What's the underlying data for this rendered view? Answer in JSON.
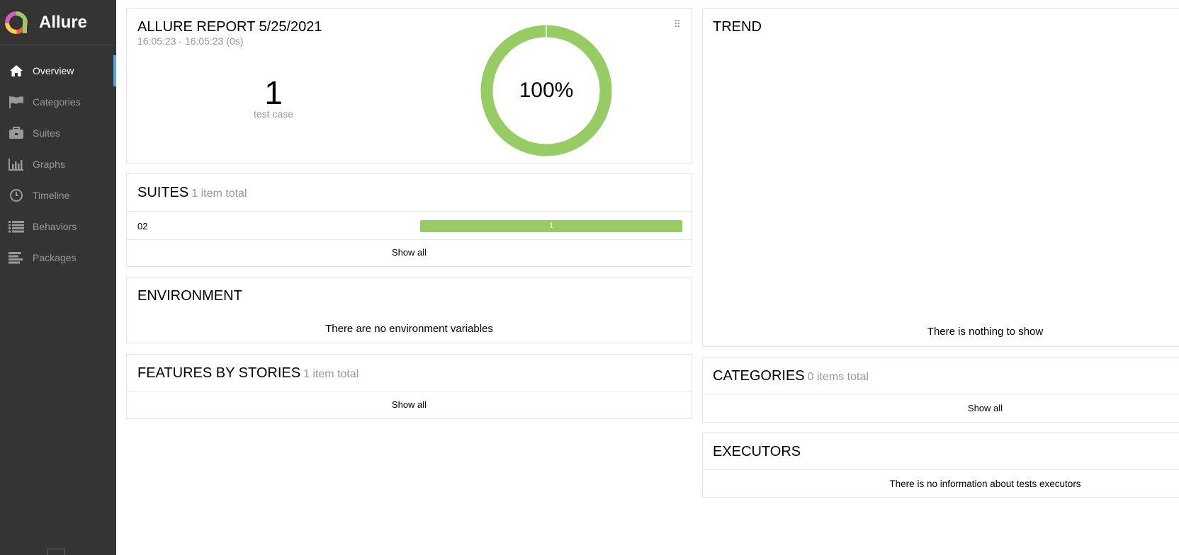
{
  "app": {
    "name": "Allure"
  },
  "sidebar": {
    "items": [
      {
        "label": "Overview",
        "icon": "home-icon",
        "active": true
      },
      {
        "label": "Categories",
        "icon": "flag-icon",
        "active": false
      },
      {
        "label": "Suites",
        "icon": "briefcase-icon",
        "active": false
      },
      {
        "label": "Graphs",
        "icon": "bar-chart-icon",
        "active": false
      },
      {
        "label": "Timeline",
        "icon": "clock-icon",
        "active": false
      },
      {
        "label": "Behaviors",
        "icon": "list-icon",
        "active": false
      },
      {
        "label": "Packages",
        "icon": "align-left-icon",
        "active": false
      }
    ]
  },
  "summary": {
    "title": "ALLURE REPORT 5/25/2021",
    "time_range": "16:05:23 - 16:05:23 (0s)",
    "count": "1",
    "count_label": "test case",
    "percent": "100%",
    "passed_fraction": 1.0
  },
  "suites": {
    "title": "SUITES",
    "total": "1 item total",
    "rows": [
      {
        "name": "02",
        "bar_label": "1",
        "passed_fraction": 1.0
      }
    ],
    "show_all": "Show all"
  },
  "environment": {
    "title": "ENVIRONMENT",
    "message": "There are no environment variables"
  },
  "features": {
    "title": "FEATURES BY STORIES",
    "total": "1 item total",
    "show_all": "Show all"
  },
  "trend": {
    "title": "TREND",
    "message": "There is nothing to show"
  },
  "categories": {
    "title": "CATEGORIES",
    "total": "0 items total",
    "show_all": "Show all"
  },
  "executors": {
    "title": "EXECUTORS",
    "message": "There is no information about tests executors"
  },
  "colors": {
    "passed": "#97cc64",
    "sidebar_bg": "#343434",
    "active_marker": "#4fa8e0"
  }
}
